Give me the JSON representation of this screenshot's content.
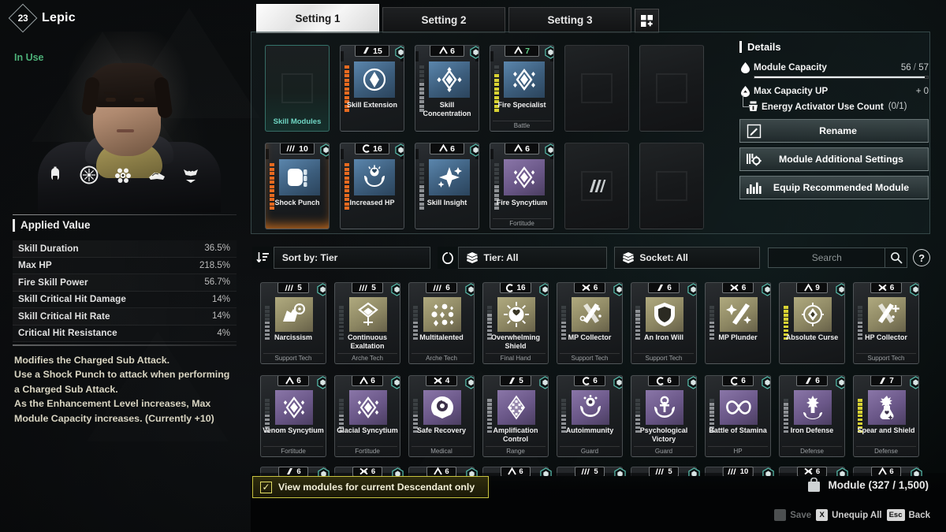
{
  "character": {
    "level": "23",
    "name": "Lepic",
    "status": "In Use",
    "icons": [
      "helmet-icon",
      "wheel-icon",
      "cells-icon",
      "gauntlet-icon",
      "winged-heart-icon"
    ]
  },
  "applied_value": {
    "title": "Applied Value",
    "stats": [
      {
        "name": "Skill Duration",
        "value": "36.5%"
      },
      {
        "name": "Max HP",
        "value": "218.5%"
      },
      {
        "name": "Fire Skill Power",
        "value": "56.7%"
      },
      {
        "name": "Skill Critical Hit Damage",
        "value": "14%"
      },
      {
        "name": "Skill Critical Hit Rate",
        "value": "14%"
      },
      {
        "name": "Critical Hit Resistance",
        "value": "4%"
      }
    ],
    "description": "Modifies the Charged Sub Attack.\nUse a Shock Punch to attack when performing a Charged Sub Attack.\nAs the Enhancement Level increases, Max Module Capacity increases. (Currently +10)"
  },
  "tabs": {
    "items": [
      {
        "label": "Setting 1",
        "active": true
      },
      {
        "label": "Setting 2",
        "active": false
      },
      {
        "label": "Setting 3",
        "active": false
      }
    ],
    "add_label": "+"
  },
  "equipped": {
    "slot_label": "Skill Modules",
    "slots": [
      {
        "name": "",
        "type": "",
        "tier": "",
        "tier_sym": "",
        "empty": true,
        "skillmod": true,
        "bar": 0,
        "bar_color": "",
        "icon": "",
        "color": "none"
      },
      {
        "name": "Skill Extension",
        "type": "",
        "tier": "15",
        "tier_sym": "cipher",
        "empty": false,
        "bar": 11,
        "bar_color": "on",
        "icon": "diamond-orb-icon",
        "color": "blue"
      },
      {
        "name": "Skill Concentration",
        "type": "",
        "tier": "6",
        "tier_sym": "arche",
        "empty": false,
        "bar": 7,
        "bar_color": "ong",
        "icon": "diamond-node-icon",
        "color": "blue"
      },
      {
        "name": "Fire Specialist",
        "type": "Battle",
        "tier": "7",
        "tier_sym": "arche",
        "tier_green": true,
        "empty": false,
        "bar": 9,
        "bar_color": "ony",
        "icon": "diamond-spark-icon",
        "color": "blue"
      },
      {
        "name": "",
        "type": "",
        "tier": "",
        "tier_sym": "",
        "empty": true,
        "icon": "",
        "color": "none"
      },
      {
        "name": "",
        "type": "",
        "tier": "",
        "tier_sym": "",
        "empty": true,
        "icon": "",
        "color": "none"
      },
      {
        "name": "Shock Punch",
        "type": "",
        "tier": "10",
        "tier_sym": "almandine",
        "empty": false,
        "bar": 11,
        "bar_color": "on",
        "icon": "fist-icon",
        "color": "blue",
        "glow": true
      },
      {
        "name": "Increased HP",
        "type": "",
        "tier": "16",
        "tier_sym": "cerulean",
        "empty": false,
        "bar": 11,
        "bar_color": "on",
        "icon": "healing-hands-icon",
        "color": "blue"
      },
      {
        "name": "Skill Insight",
        "type": "",
        "tier": "6",
        "tier_sym": "arche",
        "empty": false,
        "bar": 6,
        "bar_color": "ong",
        "icon": "sparkle-icon",
        "color": "blue"
      },
      {
        "name": "Fire Syncytium",
        "type": "Fortitude",
        "tier": "6",
        "tier_sym": "arche",
        "empty": false,
        "bar": 6,
        "bar_color": "ong",
        "icon": "diamond-cluster-icon",
        "color": "purple"
      },
      {
        "name": "",
        "type": "",
        "tier": "",
        "tier_sym": "",
        "empty": true,
        "icon": "chip-marks-icon",
        "color": "none"
      },
      {
        "name": "",
        "type": "",
        "tier": "",
        "tier_sym": "",
        "empty": true,
        "icon": "",
        "color": "none"
      }
    ]
  },
  "details": {
    "title": "Details",
    "module_capacity": {
      "label": "Module Capacity",
      "current": "56",
      "max": "57",
      "percent": 98,
      "icon": "droplet-icon"
    },
    "max_capacity_up": {
      "label": "Max Capacity UP",
      "value": "+ 0",
      "icon": "droplet-up-icon"
    },
    "energy_activator": {
      "label": "Energy Activator Use Count",
      "value": "(0/1)",
      "icon": "activator-icon"
    },
    "buttons": [
      {
        "label": "Rename",
        "icon": "pencil-icon"
      },
      {
        "label": "Module Additional Settings",
        "icon": "gears-icon"
      },
      {
        "label": "Equip Recommended Module",
        "icon": "bars-icon"
      }
    ]
  },
  "toolbar": {
    "sort_icon": "sort-desc-icon",
    "sort_label": "Sort by: Tier",
    "reset_icon": "refresh-icon",
    "tier_icon": "layers-icon",
    "tier_label": "Tier: All",
    "socket_icon": "layers-icon",
    "socket_label": "Socket: All",
    "search_placeholder": "Search",
    "search_icon": "search-icon",
    "help_label": "?"
  },
  "inventory": {
    "rows": [
      [
        {
          "name": "Narcissism",
          "type": "Support Tech",
          "tier": "5",
          "tier_sym": "almandine",
          "bar": 5,
          "bar_color": "ong",
          "icon": "wolf-scope-icon",
          "color": "gold"
        },
        {
          "name": "Continuous Exaltation",
          "type": "Arche Tech",
          "tier": "5",
          "tier_sym": "almandine",
          "bar": 0,
          "bar_color": "ong",
          "icon": "crest-icon",
          "color": "gold"
        },
        {
          "name": "Multitalented",
          "type": "Arche Tech",
          "tier": "6",
          "tier_sym": "almandine",
          "bar": 5,
          "bar_color": "ong",
          "icon": "multi-dots-icon",
          "color": "gold"
        },
        {
          "name": "Overwhelming Shield",
          "type": "Final Hand",
          "tier": "16",
          "tier_sym": "cerulean",
          "bar": 7,
          "bar_color": "ong",
          "icon": "sun-shield-icon",
          "color": "gold"
        },
        {
          "name": "MP Collector",
          "type": "Support Tech",
          "tier": "6",
          "tier_sym": "xantic",
          "bar": 5,
          "bar_color": "ong",
          "icon": "blades-icon",
          "color": "gold"
        },
        {
          "name": "An Iron Will",
          "type": "Support Tech",
          "tier": "6",
          "tier_sym": "cipher",
          "bar": 8,
          "bar_color": "ong",
          "icon": "shield-icon",
          "color": "gold"
        },
        {
          "name": "MP Plunder",
          "type": "",
          "tier": "6",
          "tier_sym": "xantic",
          "bar": 5,
          "bar_color": "ong",
          "icon": "sword-spark-icon",
          "color": "gold"
        },
        {
          "name": "Absolute Curse",
          "type": "",
          "tier": "9",
          "tier_sym": "arche",
          "bar": 9,
          "bar_color": "ony",
          "icon": "diamond-eye-icon",
          "color": "gold"
        },
        {
          "name": "HP Collector",
          "type": "Support Tech",
          "tier": "6",
          "tier_sym": "xantic",
          "bar": 5,
          "bar_color": "ong",
          "icon": "blades-plus-icon",
          "color": "gold"
        }
      ],
      [
        {
          "name": "Venom Syncytium",
          "type": "Fortitude",
          "tier": "6",
          "tier_sym": "arche",
          "bar": 5,
          "bar_color": "ong",
          "icon": "diamond-cluster-icon",
          "color": "purple"
        },
        {
          "name": "Glacial Syncytium",
          "type": "Fortitude",
          "tier": "6",
          "tier_sym": "arche",
          "bar": 5,
          "bar_color": "ong",
          "icon": "diamond-cluster-icon",
          "color": "purple"
        },
        {
          "name": "Safe Recovery",
          "type": "Medical",
          "tier": "4",
          "tier_sym": "xantic",
          "bar": 5,
          "bar_color": "ong",
          "icon": "heart-shell-icon",
          "color": "purple"
        },
        {
          "name": "Amplification Control",
          "type": "Range",
          "tier": "5",
          "tier_sym": "cipher",
          "bar": 9,
          "bar_color": "ong",
          "icon": "grid-diamond-icon",
          "color": "purple"
        },
        {
          "name": "Autoimmunity",
          "type": "Guard",
          "tier": "6",
          "tier_sym": "cerulean",
          "bar": 5,
          "bar_color": "ong",
          "icon": "smile-crest-icon",
          "color": "purple"
        },
        {
          "name": "Psychological Victory",
          "type": "Guard",
          "tier": "6",
          "tier_sym": "cerulean",
          "bar": 5,
          "bar_color": "ong",
          "icon": "anchor-crest-icon",
          "color": "purple"
        },
        {
          "name": "Battle of Stamina",
          "type": "HP",
          "tier": "6",
          "tier_sym": "cerulean",
          "bar": 8,
          "bar_color": "ong",
          "icon": "infinity-icon",
          "color": "purple"
        },
        {
          "name": "Iron Defense",
          "type": "Defense",
          "tier": "6",
          "tier_sym": "cipher",
          "bar": 8,
          "bar_color": "ong",
          "icon": "tower-icon",
          "color": "purple"
        },
        {
          "name": "Spear and Shield",
          "type": "Defense",
          "tier": "7",
          "tier_sym": "cipher",
          "bar": 9,
          "bar_color": "ony",
          "icon": "potion-icon",
          "color": "purple"
        }
      ]
    ],
    "partial_row": [
      {
        "tier": "6",
        "tier_sym": "cipher"
      },
      {
        "tier": "6",
        "tier_sym": "xantic"
      },
      {
        "tier": "6",
        "tier_sym": "arche"
      },
      {
        "tier": "6",
        "tier_sym": "arche"
      },
      {
        "tier": "5",
        "tier_sym": "almandine"
      },
      {
        "tier": "5",
        "tier_sym": "almandine"
      },
      {
        "tier": "10",
        "tier_sym": "almandine"
      },
      {
        "tier": "6",
        "tier_sym": "xantic"
      },
      {
        "tier": "6",
        "tier_sym": "arche"
      }
    ]
  },
  "footer": {
    "checkbox_label": "View modules for current Descendant only",
    "checkbox_checked": true,
    "module_icon": "bag-icon",
    "module_count": "Module (327 / 1,500)",
    "hints": [
      {
        "key": "",
        "label": "Save",
        "dim": true
      },
      {
        "key": "X",
        "label": "Unequip All",
        "dim": false
      },
      {
        "key": "Esc",
        "label": "Back",
        "dim": false
      }
    ]
  },
  "colors": {
    "accent_teal": "#6fd6c4",
    "accent_yellow": "#c8c33f",
    "status_green": "#4caf77",
    "orange_bar": "#e86a20"
  }
}
